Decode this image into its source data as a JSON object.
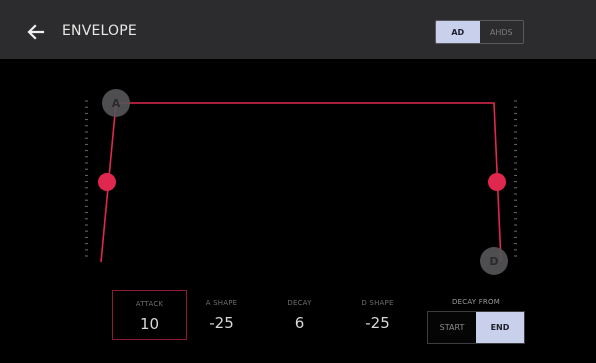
{
  "header": {
    "back_icon": "arrow-left-icon",
    "title": "ENVELOPE",
    "mode_options": [
      "AD",
      "AHDS"
    ],
    "selected_mode": "AD"
  },
  "graph": {
    "attack_handle_label": "A",
    "decay_handle_label": "D",
    "line_color": "#e0284f",
    "handle_color": "#e0284f"
  },
  "params": [
    {
      "label": "ATTACK",
      "value": "10",
      "selected": true
    },
    {
      "label": "A SHAPE",
      "value": "-25",
      "selected": false
    },
    {
      "label": "DECAY",
      "value": "6",
      "selected": false
    },
    {
      "label": "D SHAPE",
      "value": "-25",
      "selected": false
    }
  ],
  "decay_from": {
    "label": "DECAY FROM",
    "options": [
      "START",
      "END"
    ],
    "selected": "END"
  },
  "colors": {
    "accent": "#e0284f",
    "selected_fill": "#c9d0ec",
    "header_bg": "#2c2c2e"
  }
}
